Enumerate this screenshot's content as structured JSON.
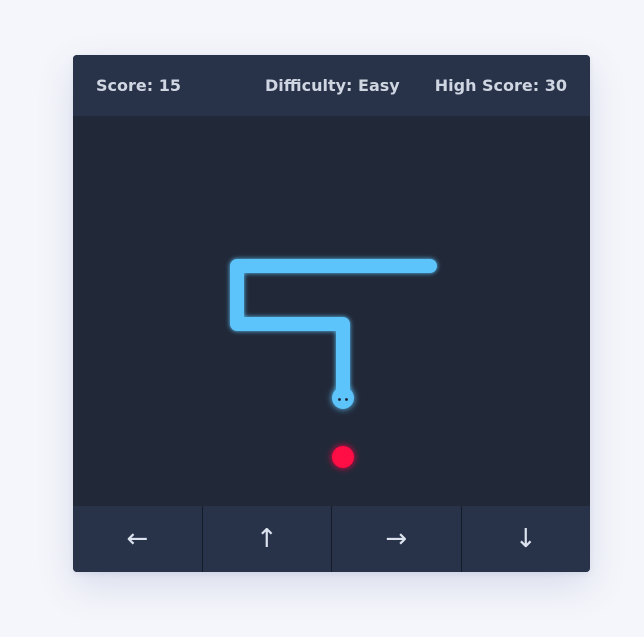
{
  "header": {
    "score": "Score: 15",
    "difficulty": "Difficulty: Easy",
    "high_score": "High Score: 30"
  },
  "controls": {
    "left": "←",
    "up": "↑",
    "right": "→",
    "down": "↓"
  },
  "colors": {
    "snake": "#5cc4fb",
    "food": "#ff0844",
    "board": "#212838",
    "panel": "#28334a"
  }
}
